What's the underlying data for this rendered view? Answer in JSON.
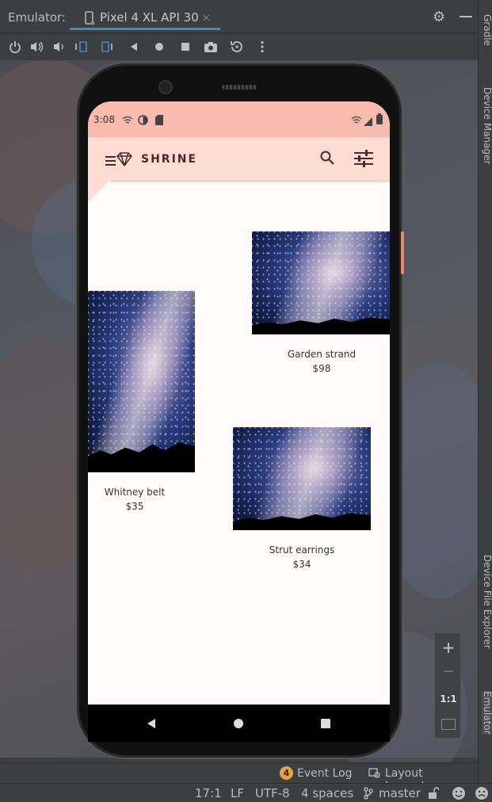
{
  "ide": {
    "emulator_label": "Emulator:",
    "device_tab": "Pixel 4 XL API 30",
    "tab_close": "×",
    "right_tabs": [
      "Gradle",
      "Device Manager",
      "Device File Explorer",
      "Emulator"
    ],
    "zoom": {
      "plus": "+",
      "minus": "−",
      "one_to_one": "1:1"
    },
    "tool_windows": {
      "event_log_count": "4",
      "event_log": "Event Log",
      "layout_inspector": "Layout Inspector"
    },
    "status": {
      "position": "17:1",
      "line_sep": "LF",
      "encoding": "UTF-8",
      "indent": "4 spaces",
      "branch": "master"
    }
  },
  "toolbar_icons": [
    "power-icon",
    "volume-up-icon",
    "volume-down-icon",
    "rotate-left-icon",
    "rotate-right-icon",
    "back-icon",
    "home-icon",
    "overview-icon",
    "camera-icon",
    "snapshot-icon",
    "more-icon"
  ],
  "device": {
    "status_time": "3:08",
    "app_title": "SHRINE",
    "products": [
      {
        "name": "Garden strand",
        "price": "$98"
      },
      {
        "name": "Whitney belt",
        "price": "$35"
      },
      {
        "name": "Strut earrings",
        "price": "$34"
      }
    ],
    "colors": {
      "status_bar": "#f9bbae",
      "app_bar": "#fcdcd2",
      "background": "#fffbfa",
      "title": "#442c2e",
      "ide_bg": "#3c3f41",
      "accent": "#4a88c7"
    }
  }
}
